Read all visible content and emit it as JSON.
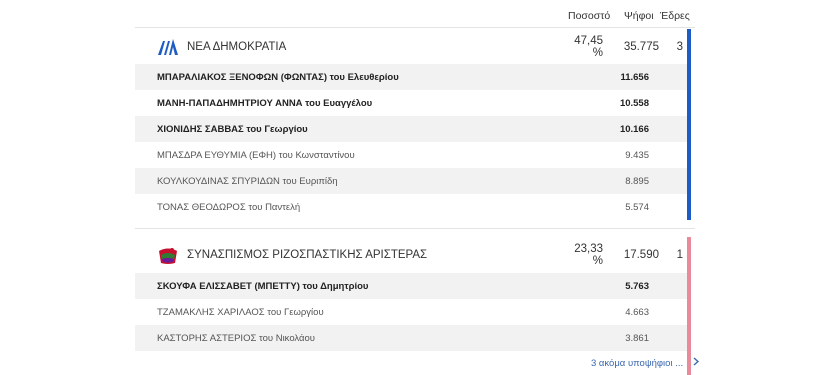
{
  "headers": {
    "pct": "Ποσοστό",
    "votes": "Ψήφοι",
    "seats": "Έδρες"
  },
  "colors": {
    "nd": "#1c5cc4",
    "syriza": "#e98a9b",
    "link": "#3a67b0"
  },
  "parties": [
    {
      "name": "ΝΕΑ ΔΗΜΟΚΡΑΤΙΑ",
      "pct": "47,45 %",
      "votes": "35.775",
      "seats": "3",
      "candidates": [
        {
          "name": "ΜΠΑΡΑΛΙΑΚΟΣ ΞΕΝΟΦΩΝ (ΦΩΝΤΑΣ) του Ελευθερίου",
          "votes": "11.656"
        },
        {
          "name": "ΜΑΝΗ-ΠΑΠΑΔΗΜΗΤΡΙΟΥ ΑΝΝΑ του Ευαγγέλου",
          "votes": "10.558"
        },
        {
          "name": "ΧΙΟΝΙΔΗΣ ΣΑΒΒΑΣ του Γεωργίου",
          "votes": "10.166"
        },
        {
          "name": "ΜΠΑΣΔΡΑ ΕΥΘΥΜΙΑ (ΕΦΗ) του Κωνσταντίνου",
          "votes": "9.435"
        },
        {
          "name": "ΚΟΥΛΚΟΥΔΙΝΑΣ ΣΠΥΡΙΔΩΝ του Ευριπίδη",
          "votes": "8.895"
        },
        {
          "name": "ΤΟΝΑΣ ΘΕΟΔΩΡΟΣ του Παντελή",
          "votes": "5.574"
        }
      ]
    },
    {
      "name": "ΣΥΝΑΣΠΙΣΜΟΣ ΡΙΖΟΣΠΑΣΤΙΚΗΣ ΑΡΙΣΤΕΡΑΣ",
      "pct": "23,33 %",
      "votes": "17.590",
      "seats": "1",
      "candidates": [
        {
          "name": "ΣΚΟΥΦΑ ΕΛΙΣΣΑΒΕΤ (ΜΠΕΤΤΥ) του Δημητρίου",
          "votes": "5.763"
        },
        {
          "name": "ΤΖΑΜΑΚΛΗΣ ΧΑΡΙΛΑΟΣ του Γεωργίου",
          "votes": "4.663"
        },
        {
          "name": "ΚΑΣΤΟΡΗΣ ΑΣΤΕΡΙΟΣ του Νικολάου",
          "votes": "3.861"
        }
      ]
    }
  ],
  "more_link": {
    "label": "3 ακόμα υποψήφιοι ...",
    "icon": "chevron-right-icon"
  }
}
